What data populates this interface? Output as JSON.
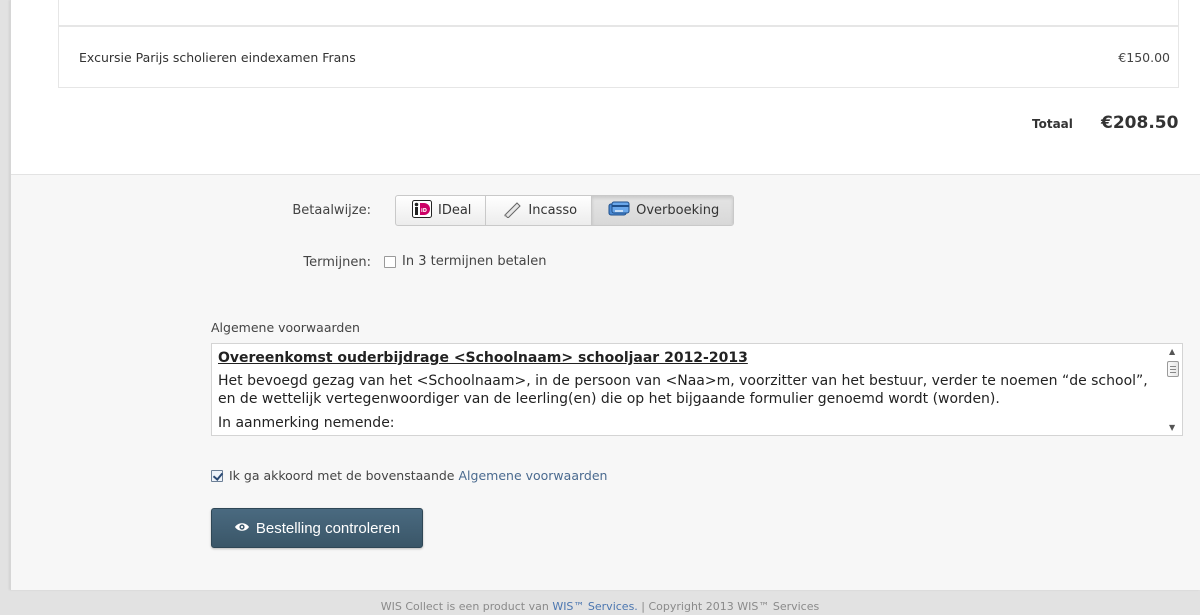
{
  "order": {
    "item_description": "Excursie Parijs scholieren eindexamen Frans",
    "item_price": "€150.00",
    "total_label": "Totaal",
    "total_value": "€208.50"
  },
  "payment": {
    "method_label": "Betaalwijze:",
    "methods": [
      {
        "label": "IDeal",
        "icon": "ideal-logo-icon",
        "active": false
      },
      {
        "label": "Incasso",
        "icon": "pen-icon",
        "active": false
      },
      {
        "label": "Overboeking",
        "icon": "bank-transfer-icon",
        "active": true
      }
    ],
    "installments_label": "Termijnen:",
    "installments_option": "In 3 termijnen betalen",
    "installments_checked": false
  },
  "terms": {
    "title": "Algemene voorwaarden",
    "heading": "Overeenkomst ouderbijdrage <Schoolnaam> schooljaar 2012-2013",
    "paragraph": "Het bevoegd gezag van het <Schoolnaam>, in de persoon van <Naa>m, voorzitter van het bestuur,  verder te noemen “de school”, en de wettelijk vertegenwoordiger van de leerling(en) die op het bijgaande formulier genoemd wordt (worden).",
    "cut_line": "In aanmerking nemende:",
    "agree_text": "Ik ga akkoord met de bovenstaande",
    "agree_link": "Algemene voorwaarden",
    "agree_checked": true
  },
  "actions": {
    "check_order_label": "Bestelling controleren"
  },
  "footer": {
    "text_before": "WIS Collect is een product van",
    "link": "WIS™ Services.",
    "text_after": "| Copyright 2013 WIS™ Services"
  },
  "colors": {
    "primary_button": "#3f5b6e",
    "link": "#4b76b0",
    "ideal_pink": "#cc0066"
  }
}
